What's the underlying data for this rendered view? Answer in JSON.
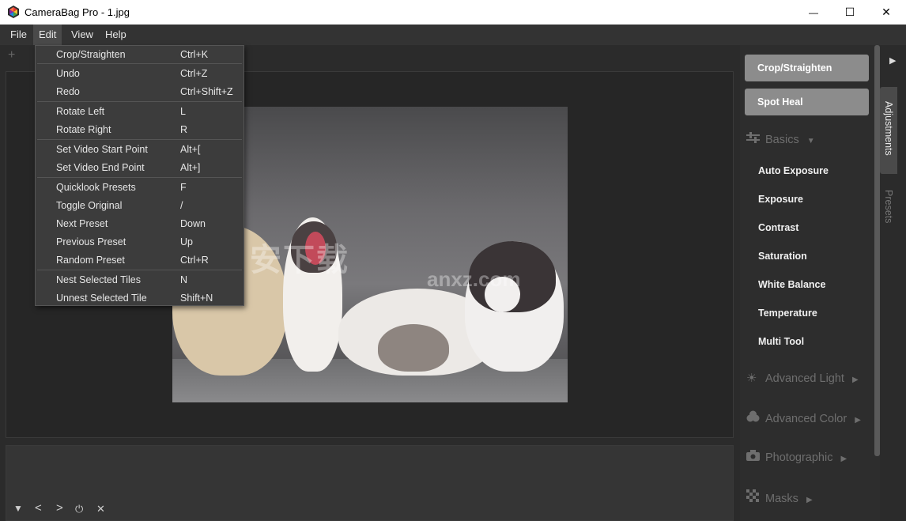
{
  "window": {
    "title": "CameraBag Pro - 1.jpg",
    "controls": {
      "minimize": "—",
      "maximize": "☐",
      "close": "✕"
    }
  },
  "menubar": {
    "items": [
      {
        "label": "File"
      },
      {
        "label": "Edit",
        "active": true
      },
      {
        "label": "View"
      },
      {
        "label": "Help"
      }
    ]
  },
  "toolbar": {
    "add_symbol": "+"
  },
  "edit_menu": {
    "items": [
      {
        "label": "Crop/Straighten",
        "shortcut": "Ctrl+K"
      },
      {
        "label": "Undo",
        "shortcut": "Ctrl+Z"
      },
      {
        "label": "Redo",
        "shortcut": "Ctrl+Shift+Z"
      },
      {
        "label": "Rotate Left",
        "shortcut": "L"
      },
      {
        "label": "Rotate Right",
        "shortcut": "R"
      },
      {
        "label": "Set Video Start Point",
        "shortcut": "Alt+["
      },
      {
        "label": "Set Video End Point",
        "shortcut": "Alt+]"
      },
      {
        "label": "Quicklook Presets",
        "shortcut": "F"
      },
      {
        "label": "Toggle Original",
        "shortcut": "/"
      },
      {
        "label": "Next Preset",
        "shortcut": "Down"
      },
      {
        "label": "Previous Preset",
        "shortcut": "Up"
      },
      {
        "label": "Random Preset",
        "shortcut": "Ctrl+R"
      },
      {
        "label": "Nest Selected Tiles",
        "shortcut": "N"
      },
      {
        "label": "Unnest Selected Tile",
        "shortcut": "Shift+N"
      }
    ]
  },
  "watermark": {
    "text": "安下载",
    "sub": "anxz.com"
  },
  "filmstrip": {
    "controls": [
      "▼",
      "<",
      ">",
      "⏻",
      "✕"
    ]
  },
  "right_panel": {
    "buttons": [
      {
        "label": "Crop/Straighten"
      },
      {
        "label": "Spot Heal"
      }
    ],
    "basics": {
      "title": "Basics",
      "items": [
        "Auto Exposure",
        "Exposure",
        "Contrast",
        "Saturation",
        "White Balance",
        "Temperature",
        "Multi Tool"
      ]
    },
    "sections": [
      {
        "title": "Advanced Light"
      },
      {
        "title": "Advanced Color"
      },
      {
        "title": "Photographic"
      },
      {
        "title": "Masks"
      }
    ]
  },
  "side_tabs": {
    "adjustments": "Adjustments",
    "presets": "Presets"
  },
  "colors": {
    "button_bg": "#8c8c8c",
    "menu_bg": "#3c3c3c",
    "panel_bg": "#2d2d2d"
  }
}
